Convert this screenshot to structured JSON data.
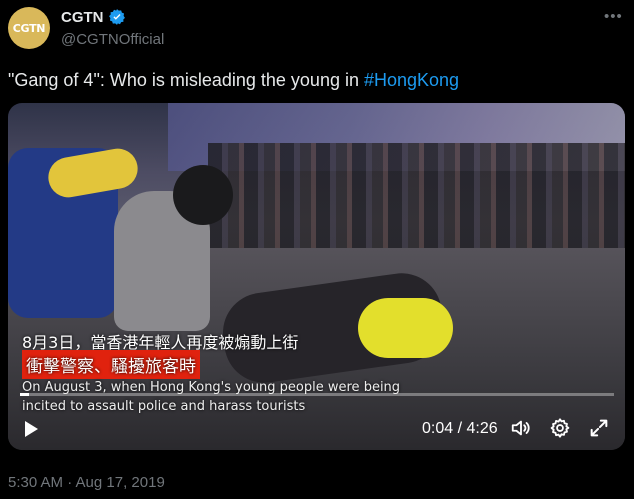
{
  "author": {
    "avatar_text": "CGTN",
    "name": "CGTN",
    "handle": "@CGTNOfficial",
    "verified": true,
    "more_icon": "more-horizontal-icon"
  },
  "tweet": {
    "text_before": "\"Gang of 4\": Who is misleading the young in ",
    "hashtag": "#HongKong"
  },
  "video": {
    "subtitles": {
      "zh_line1": "8月3日，當香港年輕人再度被煽動上街",
      "zh_line2": "衝擊警察、騷擾旅客時",
      "en_line1": "On August 3, when Hong Kong's young people were being",
      "en_line2": "incited to assault police and harass tourists"
    },
    "time_display": "0:04 / 4:26",
    "progress_fraction": 0.015,
    "controls": {
      "play_icon": "play-icon",
      "volume_icon": "volume-icon",
      "settings_icon": "gear-icon",
      "fullscreen_icon": "fullscreen-icon"
    }
  },
  "timestamp": "5:30 AM · Aug 17, 2019",
  "colors": {
    "background": "#000000",
    "text": "#e7e9ea",
    "secondary": "#71767b",
    "link": "#1d9bf0",
    "avatar_bg": "#d9b85a",
    "subtitle_highlight": "#e0220e"
  }
}
